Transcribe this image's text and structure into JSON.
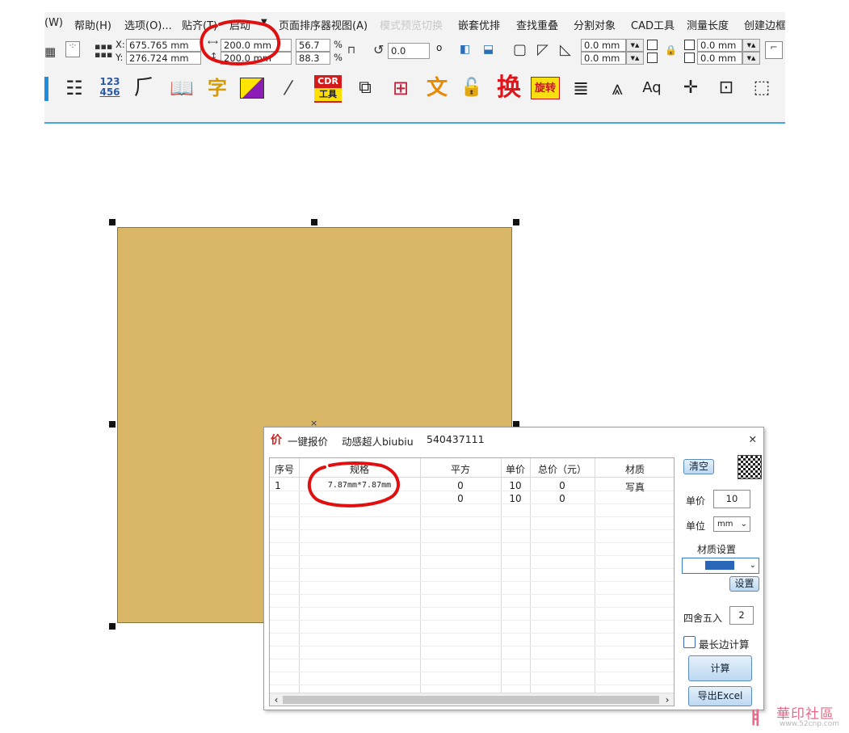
{
  "menubar": {
    "items": [
      "(W)",
      "帮助(H)",
      "选项(O)...",
      "贴齐(T)",
      "启动",
      "页面排序器视图(A)",
      "模式预览切换",
      "嵌套优排",
      "查找重叠",
      "分割对象",
      "CAD工具",
      "测量长度",
      "创建边框"
    ]
  },
  "propbar": {
    "x_label": "X:",
    "x_value": "675.765 mm",
    "y_label": "Y:",
    "y_value": "276.724 mm",
    "width_value": "200.0 mm",
    "height_value": "200.0 mm",
    "scale_w": "56.7",
    "scale_h": "88.3",
    "percent": "%",
    "rotation": "0.0",
    "degree": "o",
    "offset1": "0.0 mm",
    "offset2": "0.0 mm",
    "offset3": "0.0 mm",
    "offset4": "0.0 mm"
  },
  "toolbar": {
    "tools": [
      {
        "icon": "list-icon",
        "glyph": "☷"
      },
      {
        "icon": "number-123-icon",
        "glyph": "123"
      },
      {
        "icon": "curves-icon",
        "glyph": "⺁"
      },
      {
        "icon": "book-icon",
        "glyph": "▥"
      },
      {
        "icon": "character-icon",
        "glyph": "字"
      },
      {
        "icon": "color-icon",
        "glyph": "▟"
      },
      {
        "icon": "eyedropper-icon",
        "glyph": "⁄"
      },
      {
        "icon": "cdr-tools-icon",
        "glyph": "CDR"
      },
      {
        "icon": "sequence-icon",
        "glyph": "⧉"
      },
      {
        "icon": "grid-number-icon",
        "glyph": "⊞"
      },
      {
        "icon": "text-icon",
        "glyph": "文"
      },
      {
        "icon": "unlock-all-icon",
        "glyph": "🔓"
      },
      {
        "icon": "replace-icon",
        "glyph": "换"
      },
      {
        "icon": "rotate-icon",
        "glyph": "旋转"
      },
      {
        "icon": "text-style-icon",
        "glyph": "≣"
      },
      {
        "icon": "measure-icon",
        "glyph": "⩓"
      },
      {
        "icon": "find-text-icon",
        "glyph": "A"
      },
      {
        "icon": "crosshair-icon",
        "glyph": "✛"
      },
      {
        "icon": "align-center-icon",
        "glyph": "⊡"
      },
      {
        "icon": "select-icon",
        "glyph": "⬚"
      }
    ],
    "cdr_top": "CDR",
    "cdr_bottom": "工具",
    "rotate_label": "旋转",
    "num_top": "123",
    "num_bottom": "456"
  },
  "dialog": {
    "icon_char": "价",
    "title": "一键报价",
    "author": "动感超人biubiu",
    "qq": "540437111",
    "columns": [
      "序号",
      "规格",
      "平方",
      "单价",
      "总价（元）",
      "材质"
    ],
    "rows": [
      [
        "1",
        "7.87mm*7.87mm",
        "0",
        "10",
        "0",
        "写真"
      ],
      [
        "",
        "",
        "0",
        "10",
        "0",
        ""
      ]
    ],
    "clear_label": "清空",
    "unit_price_label": "单价",
    "unit_price_value": "10",
    "unit_label": "单位",
    "unit_value": "mm",
    "material_settings_label": "材质设置",
    "settings_button": "设置",
    "rounding_label": "四舍五入",
    "rounding_value": "2",
    "longest_side_label": "最长边计算",
    "calculate_label": "计算",
    "export_label": "导出Excel"
  },
  "watermark": {
    "logo_text": "華印社區",
    "url": "www.52cnp.com"
  },
  "colors": {
    "shape_fill": "#d9b766",
    "annotation": "#e01010",
    "accent_line": "#46a6df"
  }
}
